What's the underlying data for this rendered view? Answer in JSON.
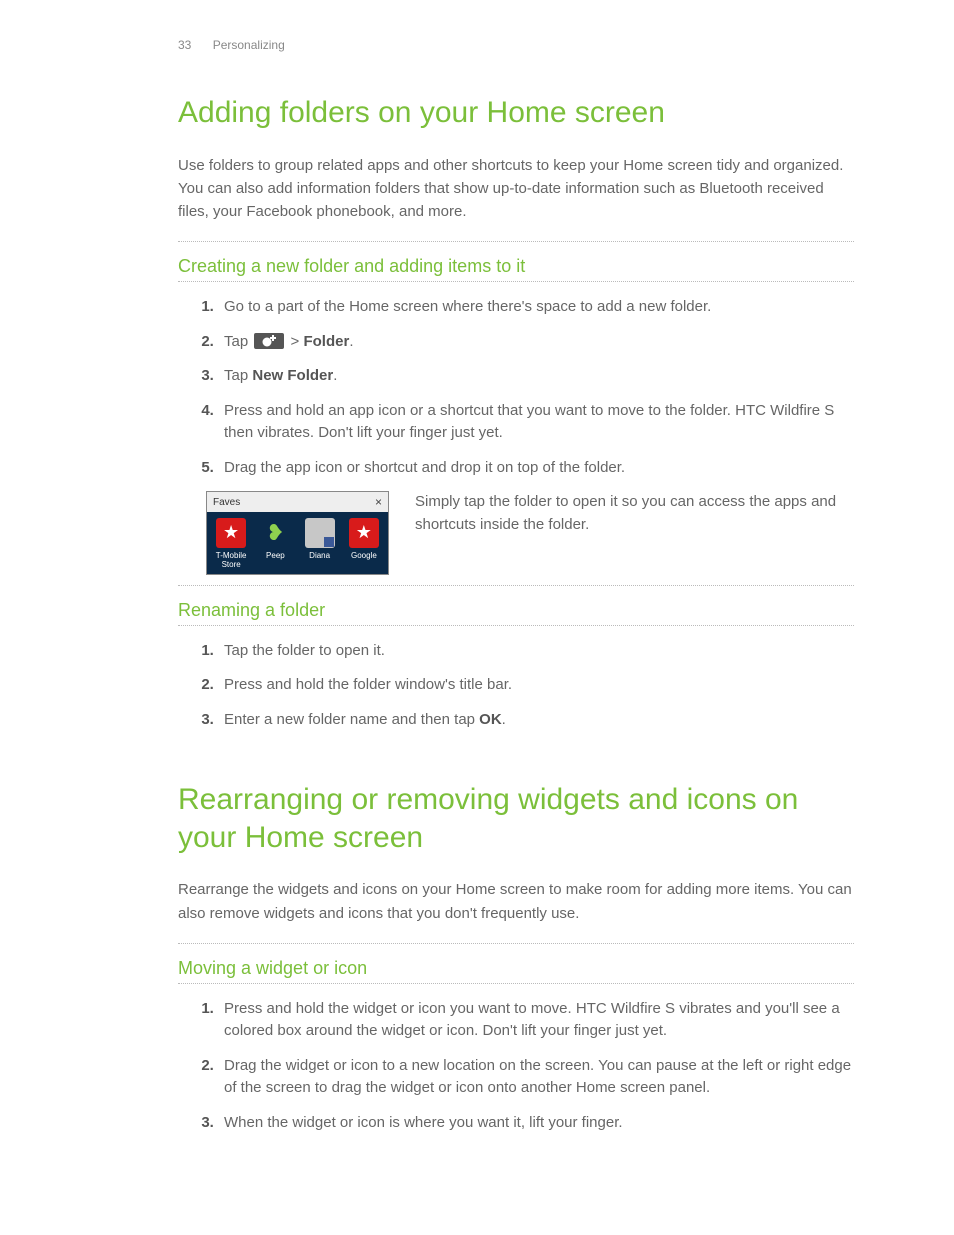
{
  "header": {
    "page_number": "33",
    "section": "Personalizing"
  },
  "h1_a": "Adding folders on your Home screen",
  "intro_a": "Use folders to group related apps and other shortcuts to keep your Home screen tidy and organized. You can also add information folders that show up-to-date information such as Bluetooth received files, your Facebook phonebook, and more.",
  "sub_a1": "Creating a new folder and adding items to it",
  "steps_a1": {
    "s1": "Go to a part of the Home screen where there's space to add a new folder.",
    "s2_pre": "Tap ",
    "s2_post": " > ",
    "s2_folder": "Folder",
    "s2_dot": ".",
    "s3_pre": "Tap ",
    "s3_nf": "New Folder",
    "s3_dot": ".",
    "s4": "Press and hold an app icon or a shortcut that you want to move to the folder. HTC Wildfire S then vibrates. Don't lift your finger just yet.",
    "s5": "Drag the app icon or shortcut and drop it on top of the folder."
  },
  "figure": {
    "title": "Faves",
    "close": "×",
    "items": [
      "T-Mobile Store",
      "Peep",
      "Diana",
      "Google"
    ],
    "caption": "Simply tap the folder to open it so you can access the apps and shortcuts inside the folder."
  },
  "sub_a2": "Renaming a folder",
  "steps_a2": {
    "s1": "Tap the folder to open it.",
    "s2": "Press and hold the folder window's title bar.",
    "s3_pre": "Enter a new folder name and then tap ",
    "s3_ok": "OK",
    "s3_dot": "."
  },
  "h1_b": "Rearranging or removing widgets and icons on your Home screen",
  "intro_b": "Rearrange the widgets and icons on your Home screen to make room for adding more items. You can also remove widgets and icons that you don't frequently use.",
  "sub_b1": "Moving a widget or icon",
  "steps_b1": {
    "s1": "Press and hold the widget or icon you want to move. HTC Wildfire S vibrates and you'll see a colored box around the widget or icon. Don't lift your finger just yet.",
    "s2": "Drag the widget or icon to a new location on the screen. You can pause at the left or right edge of the screen to drag the widget or icon onto another Home screen panel.",
    "s3": "When the widget or icon is where you want it, lift your finger."
  }
}
